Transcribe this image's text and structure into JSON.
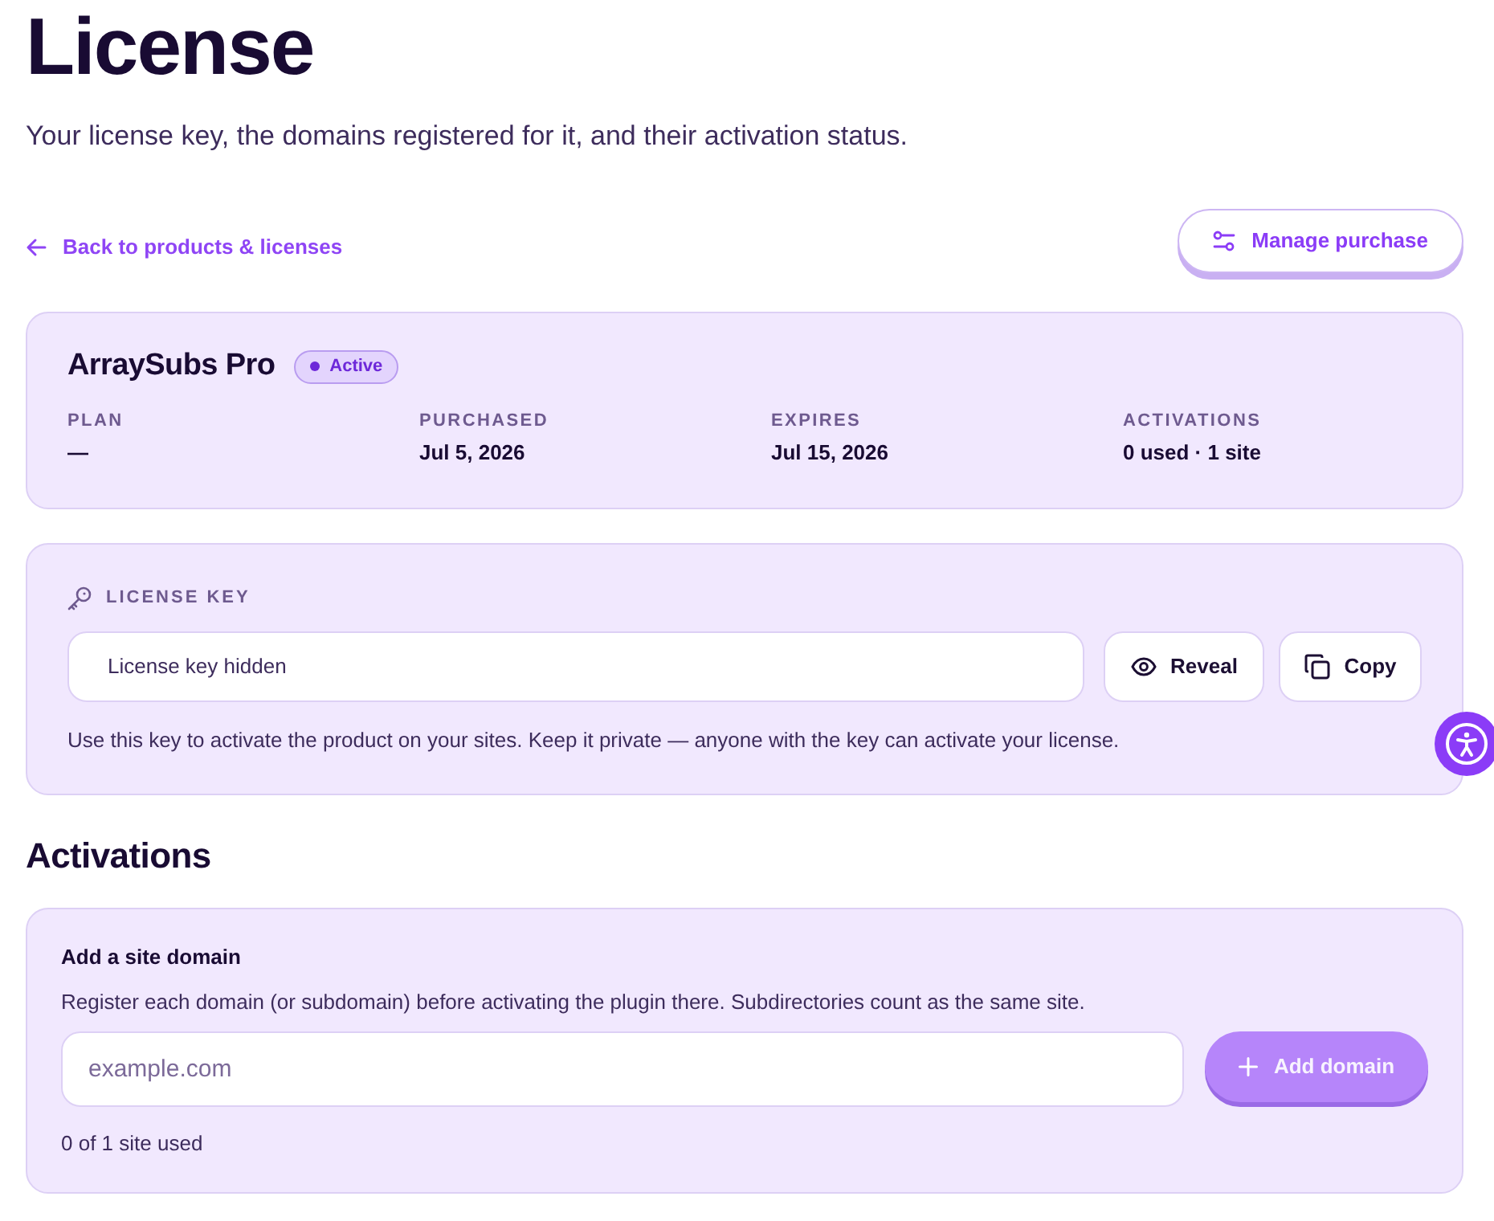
{
  "page": {
    "title": "License",
    "subtitle": "Your license key, the domains registered for it, and their activation status."
  },
  "back_link": {
    "label": "Back to products & licenses"
  },
  "manage_button": {
    "label": "Manage purchase"
  },
  "product_card": {
    "name": "ArraySubs Pro",
    "status": "Active",
    "fields": [
      {
        "label": "PLAN",
        "value": "—"
      },
      {
        "label": "PURCHASED",
        "value": "Jul 5, 2026"
      },
      {
        "label": "EXPIRES",
        "value": "Jul 15, 2026"
      },
      {
        "label": "ACTIVATIONS",
        "value": "0 used · 1 site"
      }
    ]
  },
  "license_key": {
    "heading": "LICENSE KEY",
    "value": "License key hidden",
    "buttons": [
      {
        "kind": "reveal",
        "label": "Reveal"
      },
      {
        "kind": "copy",
        "label": "Copy"
      }
    ],
    "note": "Use this key to activate the product on your sites. Keep it private — anyone with the key can activate your license."
  },
  "activations": {
    "heading": "Activations",
    "add_domain": {
      "title": "Add a site domain",
      "hint": "Register each domain (or subdomain) before activating the plugin there. Subdirectories count as the same site.",
      "placeholder": "example.com",
      "button": {
        "label": "Add domain",
        "disabled": true
      },
      "usage": "0 of 1 site used"
    }
  }
}
